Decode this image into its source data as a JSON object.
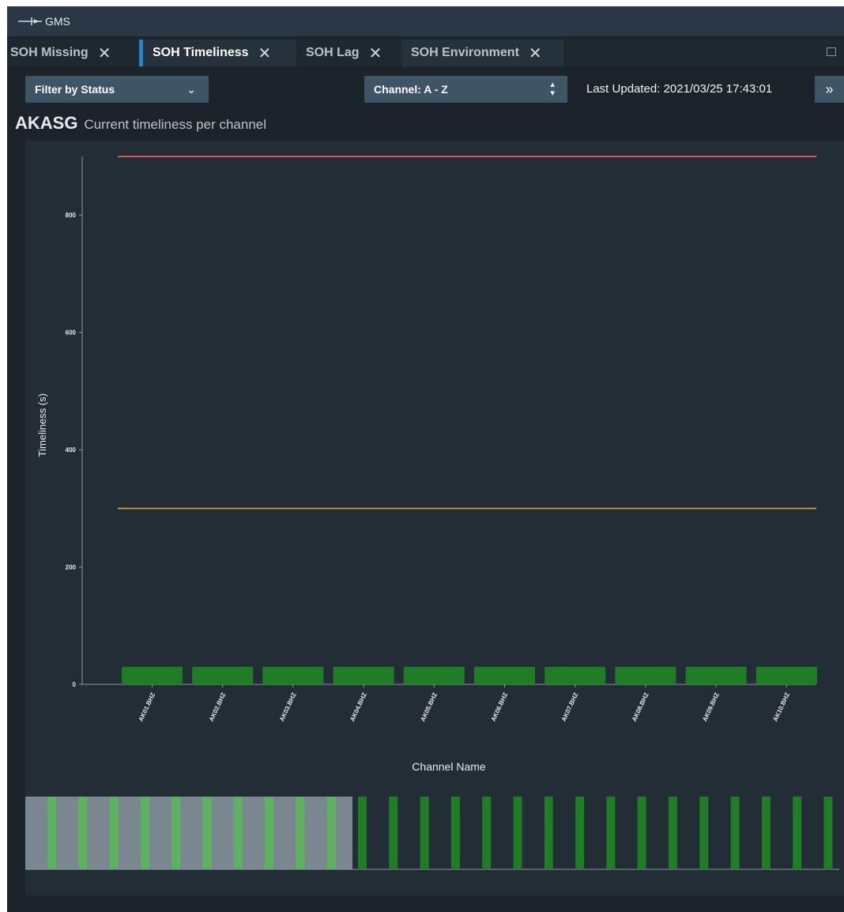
{
  "app": {
    "title": "GMS"
  },
  "tabs": [
    {
      "label": "SOH Missing",
      "active": false
    },
    {
      "label": "SOH Timeliness",
      "active": true
    },
    {
      "label": "SOH Lag",
      "active": false
    },
    {
      "label": "SOH Environment",
      "active": false
    }
  ],
  "toolbar": {
    "filter_label": "Filter by Status",
    "sort_label": "Channel: A - Z",
    "last_updated": "Last Updated: 2021/03/25 17:43:01",
    "expand_glyph": "»"
  },
  "heading": {
    "station": "AKASG",
    "subtitle": "Current timeliness per channel"
  },
  "colors": {
    "bar": "#1e7e24",
    "bar_light": "#5cb35e",
    "bad_threshold": "#d9534f",
    "marginal_threshold": "#c8961e",
    "axis": "#8a98a4",
    "brush": "#8a96a0"
  },
  "chart_data": {
    "type": "bar",
    "ylabel": "Timeliness (s)",
    "xlabel": "Channel Name",
    "ylim": [
      0,
      900
    ],
    "yticks": [
      0,
      200,
      400,
      600,
      800
    ],
    "categories": [
      "AK01.BHZ",
      "AK02.BHZ",
      "AK03.BHZ",
      "AK04.BHZ",
      "AK05.BHZ",
      "AK06.BHZ",
      "AK07.BHZ",
      "AK08.BHZ",
      "AK09.BHZ",
      "AK10.BHZ"
    ],
    "values": [
      30,
      30,
      30,
      30,
      30,
      30,
      30,
      30,
      30,
      30
    ],
    "thresholds": {
      "bad": 900,
      "marginal": 300
    },
    "overview_bar_count": 26,
    "overview_selected_count": 10
  }
}
